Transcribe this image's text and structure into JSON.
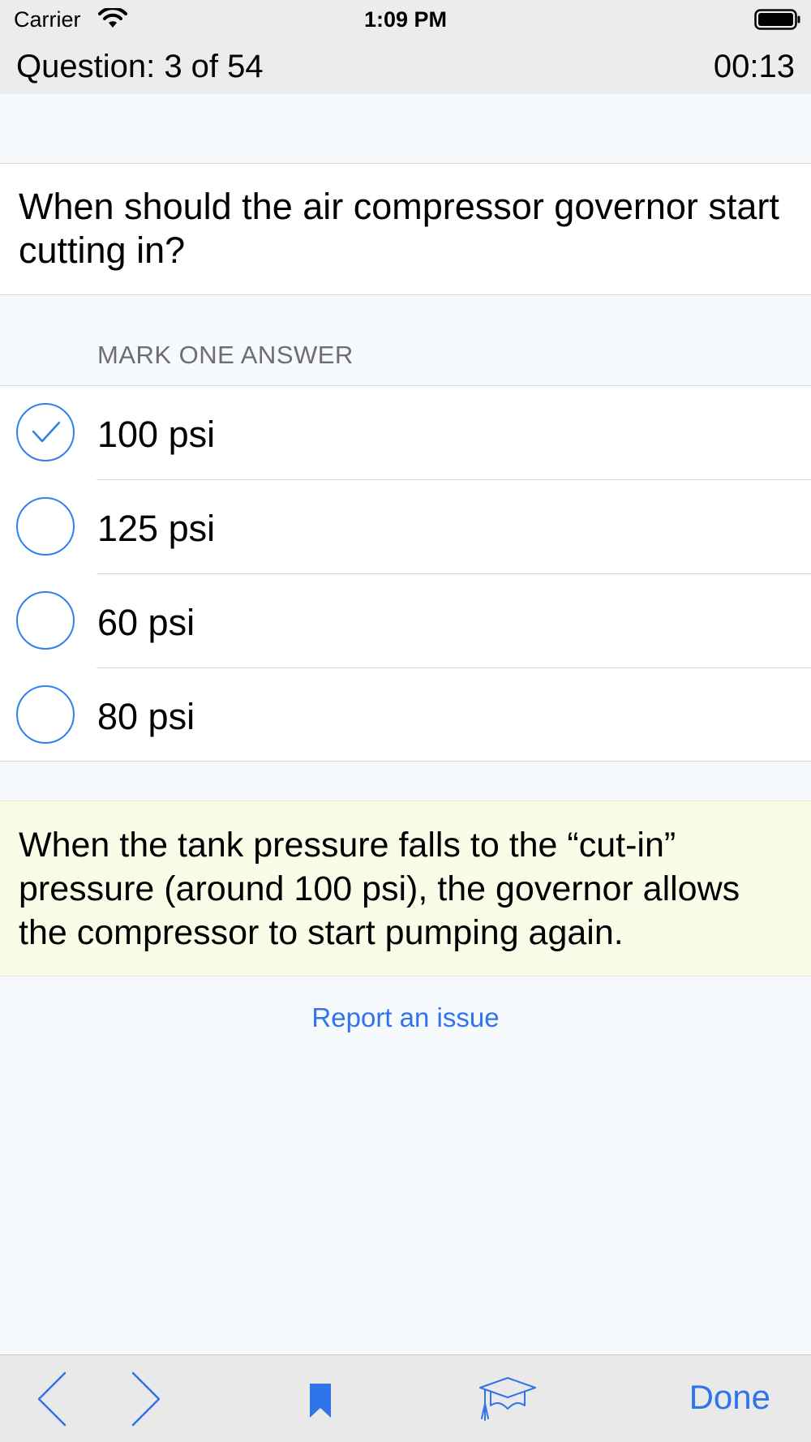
{
  "status_bar": {
    "carrier": "Carrier",
    "time": "1:09 PM"
  },
  "header": {
    "question_counter": "Question: 3 of 54",
    "timer": "00:13"
  },
  "question": {
    "text": "When should the air compressor governor start cutting in?"
  },
  "answers_label": "MARK ONE ANSWER",
  "answers": [
    {
      "label": "100 psi",
      "selected": true
    },
    {
      "label": "125 psi",
      "selected": false
    },
    {
      "label": "60 psi",
      "selected": false
    },
    {
      "label": "80 psi",
      "selected": false
    }
  ],
  "explanation": {
    "text": "When the tank pressure falls to the “cut-in” pressure (around 100 psi), the governor allows the compressor to start pumping again."
  },
  "report_link": "Report an issue",
  "toolbar": {
    "icons": [
      "chevron-left-icon",
      "chevron-right-icon",
      "bookmark-icon",
      "graduation-cap-icon"
    ],
    "done_label": "Done"
  },
  "colors": {
    "accent": "#2f74ea",
    "radio": "#2f80ed",
    "explanation_bg": "#fafce8",
    "page_bg": "#f7fafd",
    "bar_bg": "#ececec"
  }
}
